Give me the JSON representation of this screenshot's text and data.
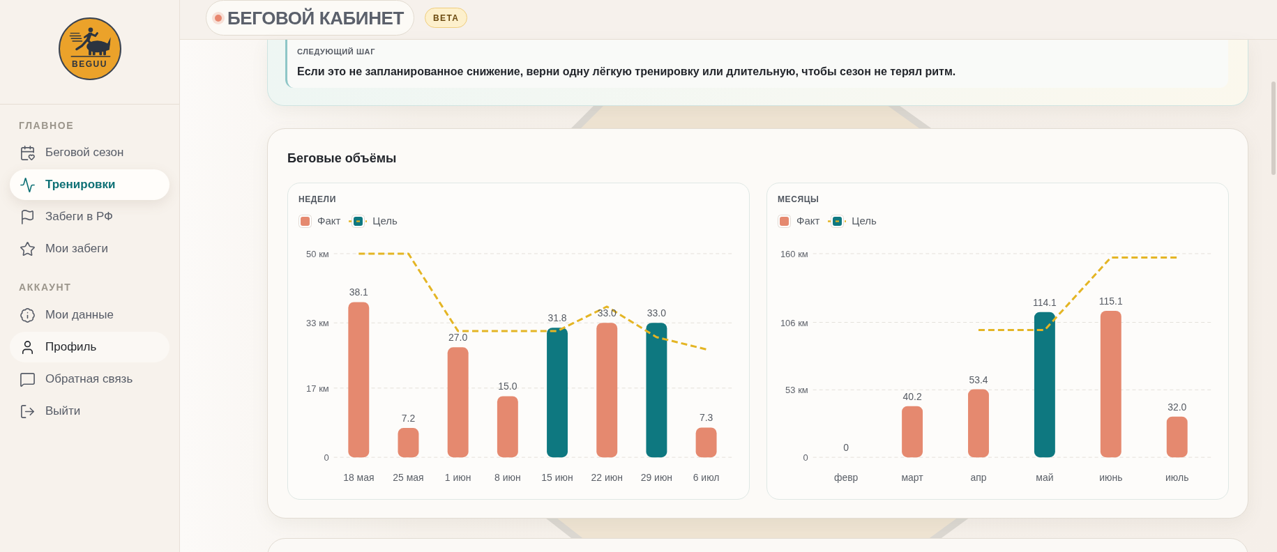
{
  "sidebar": {
    "logo": {
      "text": "BEGUU"
    },
    "sections": [
      {
        "heading": "ГЛАВНОЕ",
        "items": [
          {
            "label": "Беговой сезон",
            "selected": false,
            "hovered": false
          },
          {
            "label": "Тренировки",
            "selected": true,
            "hovered": false
          },
          {
            "label": "Забеги в РФ",
            "selected": false,
            "hovered": false
          },
          {
            "label": "Мои забеги",
            "selected": false,
            "hovered": false
          }
        ]
      },
      {
        "heading": "АККАУНТ",
        "items": [
          {
            "label": "Мои данные",
            "selected": false,
            "hovered": false
          },
          {
            "label": "Профиль",
            "selected": false,
            "hovered": true
          },
          {
            "label": "Обратная связь",
            "selected": false,
            "hovered": false
          },
          {
            "label": "Выйти",
            "selected": false,
            "hovered": false
          }
        ]
      }
    ]
  },
  "header": {
    "title": "БЕГОВОЙ КАБИНЕТ",
    "badge": "BETA"
  },
  "next_step": {
    "label": "СЛЕДУЮЩИЙ ШАГ",
    "text": "Если это не запланированное снижение, верни одну лёгкую тренировку или длительную, чтобы сезон не терял ритм."
  },
  "volumes": {
    "title": "Беговые объёмы",
    "panels": [
      {
        "title": "НЕДЕЛИ",
        "chart_data": {
          "type": "bar",
          "categories": [
            "18 мая",
            "25 мая",
            "1 июн",
            "8 июн",
            "15 июн",
            "22 июн",
            "29 июн",
            "6 июл"
          ],
          "series": [
            {
              "name": "Факт",
              "color": "#e5896f",
              "colors": [
                "#e5896f",
                "#e5896f",
                "#e5896f",
                "#e5896f",
                "#0e7880",
                "#e5896f",
                "#0e7880",
                "#e5896f"
              ],
              "values": [
                38.1,
                7.2,
                27.0,
                15.0,
                31.8,
                33.0,
                33.0,
                7.3
              ]
            },
            {
              "name": "Цель",
              "type": "line",
              "line_style": "dashed",
              "color": "#e4b524",
              "values": [
                50,
                50,
                31.0,
                31.0,
                31.0,
                37.0,
                29.5,
                26.5
              ]
            }
          ],
          "ylim": [
            0,
            50
          ],
          "yticks": [
            {
              "value": 0,
              "label": "0"
            },
            {
              "value": 17,
              "label": "17 км"
            },
            {
              "value": 33,
              "label": "33 км"
            },
            {
              "value": 50,
              "label": "50 км"
            }
          ],
          "value_labels": [
            "38.1",
            "7.2",
            "27.0",
            "15.0",
            "31.8",
            "33.0",
            "33.0",
            "7.3"
          ]
        }
      },
      {
        "title": "МЕСЯЦЫ",
        "chart_data": {
          "type": "bar",
          "categories": [
            "февр",
            "март",
            "апр",
            "май",
            "июнь",
            "июль"
          ],
          "series": [
            {
              "name": "Факт",
              "color": "#e5896f",
              "colors": [
                "#e5896f",
                "#e5896f",
                "#e5896f",
                "#0e7880",
                "#e5896f",
                "#e5896f"
              ],
              "values": [
                0,
                40.2,
                53.4,
                114.1,
                115.1,
                32.0
              ]
            },
            {
              "name": "Цель",
              "type": "line",
              "line_style": "dashed",
              "color": "#e4b524",
              "values": [
                null,
                null,
                100,
                100,
                157,
                157
              ]
            }
          ],
          "ylim": [
            0,
            160
          ],
          "yticks": [
            {
              "value": 0,
              "label": "0"
            },
            {
              "value": 53,
              "label": "53 км"
            },
            {
              "value": 106,
              "label": "106 км"
            },
            {
              "value": 160,
              "label": "160 км"
            }
          ],
          "value_labels": [
            "0",
            "40.2",
            "53.4",
            "114.1",
            "115.1",
            "32.0"
          ]
        }
      }
    ]
  }
}
